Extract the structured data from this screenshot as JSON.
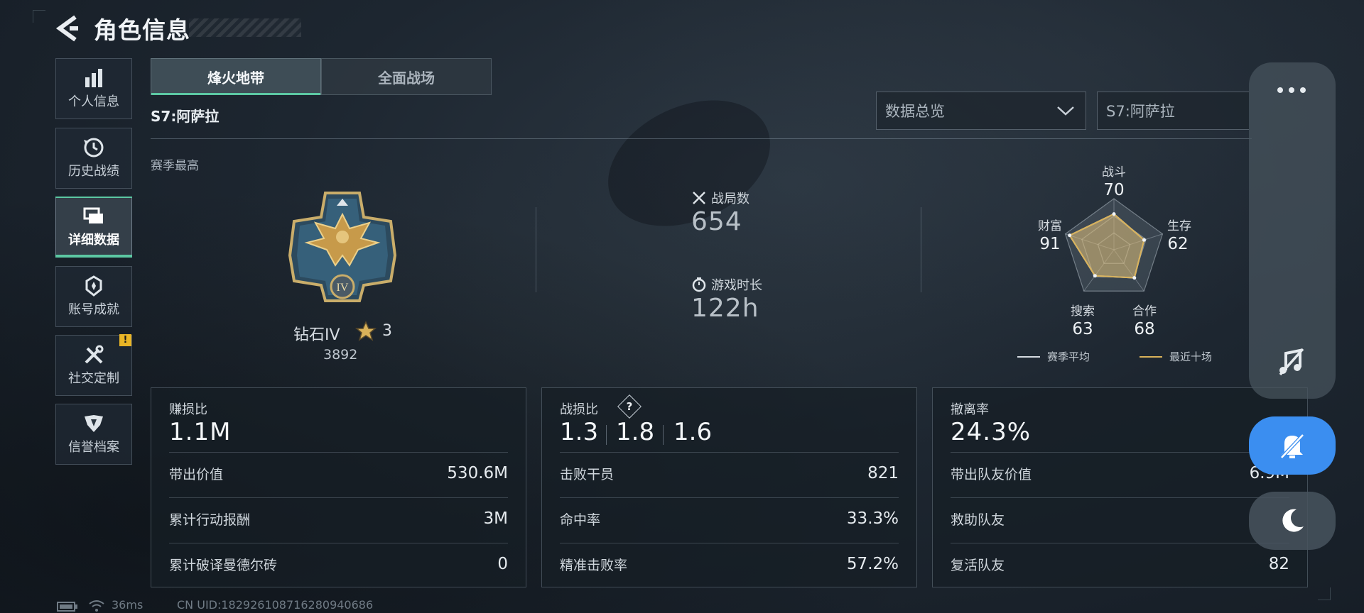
{
  "header": {
    "title": "角色信息"
  },
  "sidebar": {
    "items": [
      {
        "label": "个人信息",
        "icon": "bar-chart-icon"
      },
      {
        "label": "历史战绩",
        "icon": "clock-history-icon"
      },
      {
        "label": "详细数据",
        "icon": "folders-icon",
        "active": true
      },
      {
        "label": "账号成就",
        "icon": "achievement-icon"
      },
      {
        "label": "社交定制",
        "icon": "tools-icon",
        "badge": "!"
      },
      {
        "label": "信誉档案",
        "icon": "shield-emblem-icon"
      }
    ]
  },
  "tabs": [
    {
      "label": "烽火地带",
      "active": true
    },
    {
      "label": "全面战场",
      "active": false
    }
  ],
  "season": {
    "title": "S7:阿萨拉",
    "best_label": "赛季最高"
  },
  "filters": {
    "view": {
      "value": "数据总览"
    },
    "season": {
      "value": "S7:阿萨拉"
    }
  },
  "rank": {
    "name": "钻石IV",
    "stars": "3",
    "score": "3892",
    "medal_numeral": "IV"
  },
  "summary": {
    "matches_label": "战局数",
    "matches_value": "654",
    "playtime_label": "游戏时长",
    "playtime_value": "122h"
  },
  "radar": {
    "axes": [
      {
        "label": "战斗",
        "value": 70
      },
      {
        "label": "生存",
        "value": 62
      },
      {
        "label": "合作",
        "value": 68
      },
      {
        "label": "搜索",
        "value": 63
      },
      {
        "label": "财富",
        "value": 91
      }
    ],
    "recent_ten": [
      70,
      62,
      68,
      63,
      91
    ],
    "legend": [
      {
        "label": "赛季平均",
        "color": "#d6dce2"
      },
      {
        "label": "最近十场",
        "color": "#d9b25a"
      }
    ]
  },
  "cards": {
    "profit": {
      "title": "赚损比",
      "big": "1.1M",
      "rows": [
        {
          "k": "带出价值",
          "v": "530.6M"
        },
        {
          "k": "累计行动报酬",
          "v": "3M"
        },
        {
          "k": "累计破译曼德尔砖",
          "v": "0"
        }
      ]
    },
    "combat": {
      "title": "战损比",
      "help": "?",
      "ratios": [
        "1.3",
        "1.8",
        "1.6"
      ],
      "rows": [
        {
          "k": "击败干员",
          "v": "821"
        },
        {
          "k": "命中率",
          "v": "33.3%"
        },
        {
          "k": "精准击败率",
          "v": "57.2%"
        }
      ]
    },
    "extract": {
      "title": "撤离率",
      "big": "24.3%",
      "rows": [
        {
          "k": "带出队友价值",
          "v": "6.9M"
        },
        {
          "k": "救助队友",
          "v": ""
        },
        {
          "k": "复活队友",
          "v": "82"
        }
      ]
    }
  },
  "status_bar": {
    "ping": "36ms",
    "uid": "CN UID:182926108716280940686"
  },
  "colors": {
    "accent": "#5cc8a3",
    "gold": "#d9b25a",
    "notify_blue": "#3b8ef0",
    "badge": "#e9b526"
  }
}
